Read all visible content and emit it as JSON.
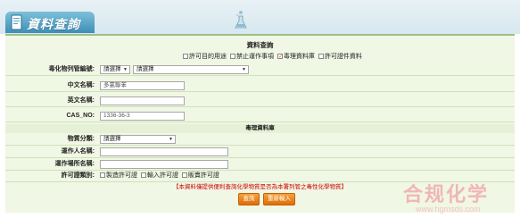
{
  "banner": {
    "title": "資料查詢"
  },
  "form": {
    "title": "資料查詢",
    "options": [
      {
        "label": "許可目的用途",
        "checked": false
      },
      {
        "label": "禁止運作事項",
        "checked": false
      },
      {
        "label": "毒理資料庫",
        "checked": true
      },
      {
        "label": "許可證件資料",
        "checked": false
      }
    ],
    "registry_label": "毒化物列管編號:",
    "registry_select1": "請選擇",
    "registry_select2": "請選擇",
    "chinese_name_label": "中文名稱:",
    "chinese_name_value": "多氯聯苯",
    "english_name_label": "英文名稱:",
    "english_name_value": "",
    "cas_label": "CAS_NO:",
    "cas_value": "1336-36-3",
    "tox_section_title": "毒理資料庫",
    "material_label": "物質分類:",
    "material_select": "請選擇",
    "operator_label": "運作人名稱:",
    "operator_value": "",
    "site_label": "運作場所名稱:",
    "site_value": "",
    "permit_type_label": "許可證類別:",
    "permit_types": [
      {
        "label": "製造許可證",
        "checked": false
      },
      {
        "label": "輸入許可證",
        "checked": false
      },
      {
        "label": "販賣許可證",
        "checked": false
      }
    ],
    "notice": "【本資料僅提供便利查詢化學物質是否為本署列管之毒性化學物質】",
    "query_button": "查詢",
    "reset_button": "重新輸入"
  },
  "watermark": {
    "title": "合规化学",
    "url": "www.hgmsds.com"
  },
  "colors": {
    "frame_bg": "#f0f7e4",
    "accent": "#dd6d0b",
    "notice": "#d00000"
  }
}
